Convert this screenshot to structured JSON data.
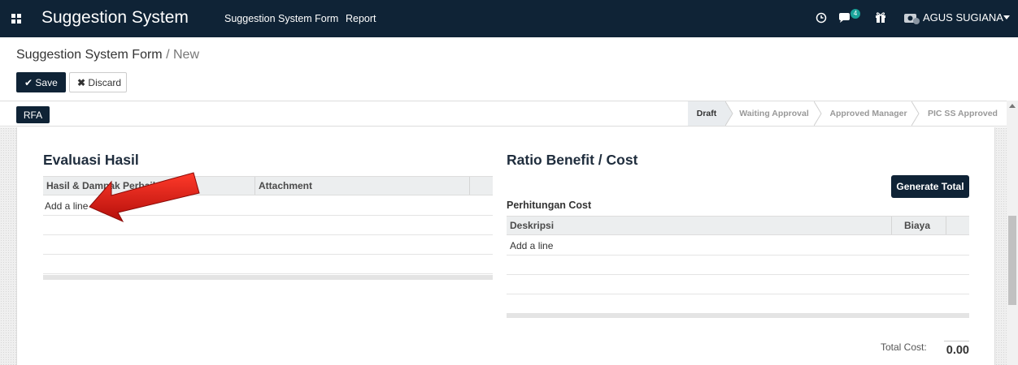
{
  "navbar": {
    "app_title": "Suggestion System",
    "menu": [
      "Suggestion System Form",
      "Report"
    ],
    "messages_badge": "4",
    "user_name": "AGUS SUGIANA"
  },
  "breadcrumb": {
    "parent": "Suggestion System Form",
    "separator": "/",
    "current": "New"
  },
  "buttons": {
    "save": "Save",
    "discard": "Discard",
    "rfa": "RFA",
    "generate_total": "Generate Total"
  },
  "statusbar": {
    "stages": [
      {
        "label": "Draft",
        "active": true
      },
      {
        "label": "Waiting Approval",
        "active": false
      },
      {
        "label": "Approved Manager",
        "active": false
      },
      {
        "label": "PIC SS Approved",
        "active": false
      }
    ]
  },
  "evaluasi": {
    "title": "Evaluasi Hasil",
    "columns": [
      "Hasil & Dampak Perbaikan",
      "Attachment"
    ],
    "add_line": "Add a line"
  },
  "ratio": {
    "title": "Ratio Benefit / Cost",
    "cost_title": "Perhitungan Cost",
    "columns": [
      "Deskripsi",
      "Biaya"
    ],
    "add_line": "Add a line",
    "total_label": "Total Cost:",
    "total_value": "0.00"
  },
  "colors": {
    "navbar": "#0f2336",
    "arrow": "#e0201b"
  }
}
